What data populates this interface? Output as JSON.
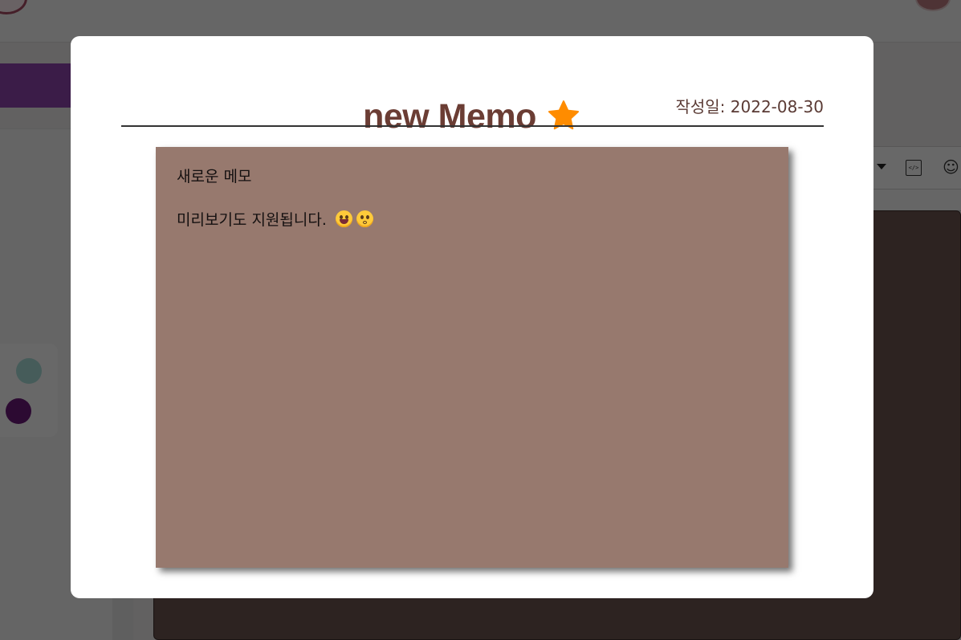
{
  "modal": {
    "title": "new Memo",
    "star_icon": "star-icon",
    "star_color": "#ff8c00",
    "created_date": "작성일: 2022-08-30",
    "title_color": "#6b3d34"
  },
  "memo": {
    "background_color": "#97796e",
    "line1": "새로운 메모",
    "line2": "미리보기도 지원됩니다.",
    "emojis": [
      "grinning-face-with-tongue-icon",
      "kissing-face-icon"
    ]
  },
  "background": {
    "editor_toolbar_icons": [
      "dropdown-caret-icon",
      "code-block-icon",
      "smiley-icon"
    ],
    "palette_colors": [
      "#a8dcd7",
      "#6a1a78"
    ],
    "accent_color": "#8e44ad"
  }
}
